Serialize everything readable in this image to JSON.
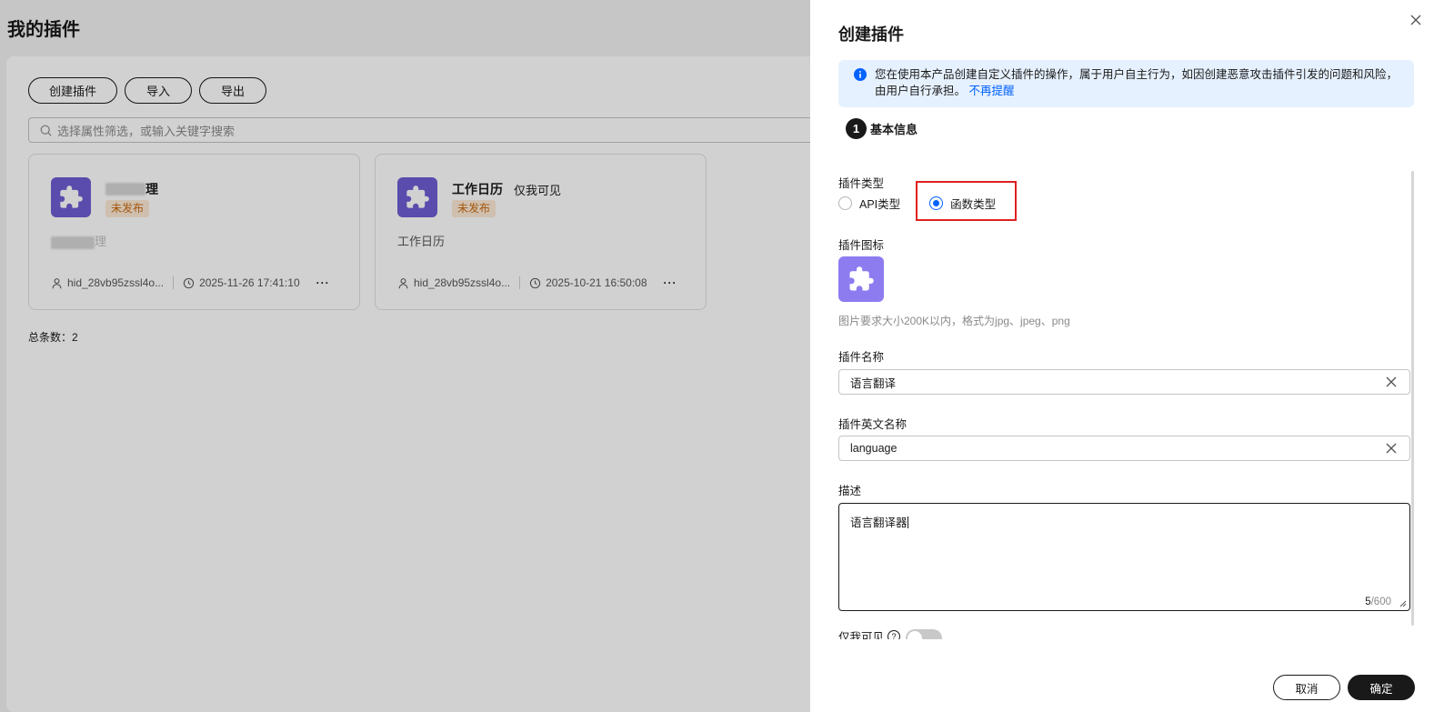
{
  "page": {
    "title": "我的插件",
    "buttons": {
      "create": "创建插件",
      "import": "导入",
      "export": "导出"
    },
    "search_placeholder": "选择属性筛选，或输入关键字搜索",
    "cards": [
      {
        "name_suffix": "理",
        "visibility": "",
        "status": "未发布",
        "desc_suffix": "理",
        "owner": "hid_28vb95zssl4o...",
        "time": "2025-11-26 17:41:10",
        "more": "···"
      },
      {
        "name_suffix": "工作日历",
        "visibility": "仅我可见",
        "status": "未发布",
        "desc_suffix": "工作日历",
        "owner": "hid_28vb95zssl4o...",
        "time": "2025-10-21 16:50:08",
        "more": "···"
      }
    ],
    "total": "总条数：2"
  },
  "drawer": {
    "title": "创建插件",
    "notice_text": "您在使用本产品创建自定义插件的操作，属于用户自主行为，如因创建恶意攻击插件引发的问题和风险，由用户自行承担。",
    "notice_link": "不再提醒",
    "step_number": "1",
    "step_label": "基本信息",
    "type_label": "插件类型",
    "type_options": [
      "API类型",
      "函数类型"
    ],
    "type_selected": "函数类型",
    "icon_label": "插件图标",
    "icon_hint": "图片要求大小200K以内，格式为jpg、jpeg、png",
    "name_label": "插件名称",
    "name_value": "语言翻译",
    "en_name_label": "插件英文名称",
    "en_name_value": "language",
    "desc_label": "描述",
    "desc_value": "语言翻译器",
    "desc_count": "5",
    "desc_max": "/600",
    "private_label": "仅我可见",
    "private_on": false,
    "cancel": "取消",
    "confirm": "确定"
  },
  "colors": {
    "accent": "#0062ff",
    "plugin_icon": "#6d5dd3",
    "plugin_icon_light": "#8c7cf0",
    "badge_bg": "#fde9d5",
    "badge_text": "#c8690f",
    "highlight": "#e02020",
    "notice_bg": "#e6f1ff"
  }
}
